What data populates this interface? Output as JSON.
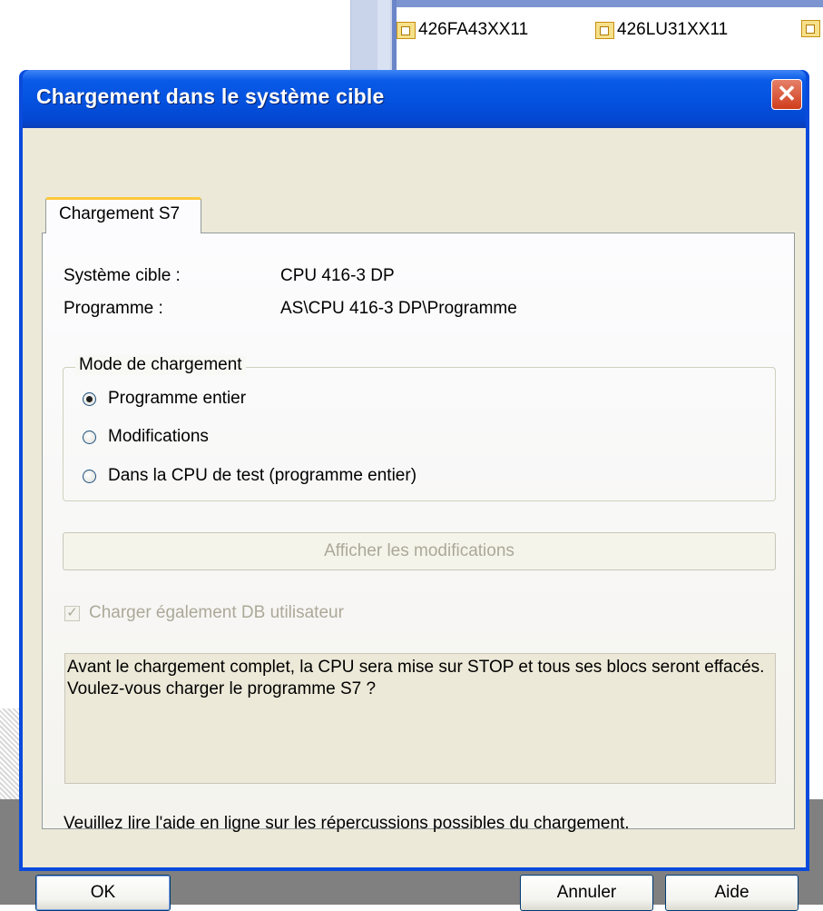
{
  "background": {
    "items": [
      {
        "label": "426FA43XX11"
      },
      {
        "label": "426LU31XX11"
      }
    ]
  },
  "dialog": {
    "title": "Chargement dans le système cible",
    "close_label": "✕",
    "tab_label": "Chargement S7",
    "target_label": "Système cible :",
    "target_value": "CPU 416-3 DP",
    "program_label": "Programme :",
    "program_value": "AS\\CPU 416-3 DP\\Programme",
    "mode_group_label": "Mode de chargement",
    "modes": [
      {
        "label": "Programme entier",
        "selected": true
      },
      {
        "label": "Modifications",
        "selected": false
      },
      {
        "label": "Dans la CPU de test (programme entier)",
        "selected": false
      }
    ],
    "show_changes_label": "Afficher les modifications",
    "load_db_label": "Charger également DB utilisateur",
    "load_db_checked": true,
    "message": "Avant le chargement complet, la CPU sera mise sur STOP et tous ses blocs seront effacés. Voulez-vous charger le programme S7 ?",
    "note": "Veuillez lire l'aide en ligne sur les répercussions possibles du chargement.",
    "ok_label": "OK",
    "cancel_label": "Annuler",
    "help_label": "Aide"
  },
  "colors": {
    "titlebar": "#0453e0",
    "client": "#ece9d8",
    "close_button": "#cf3d1c"
  }
}
